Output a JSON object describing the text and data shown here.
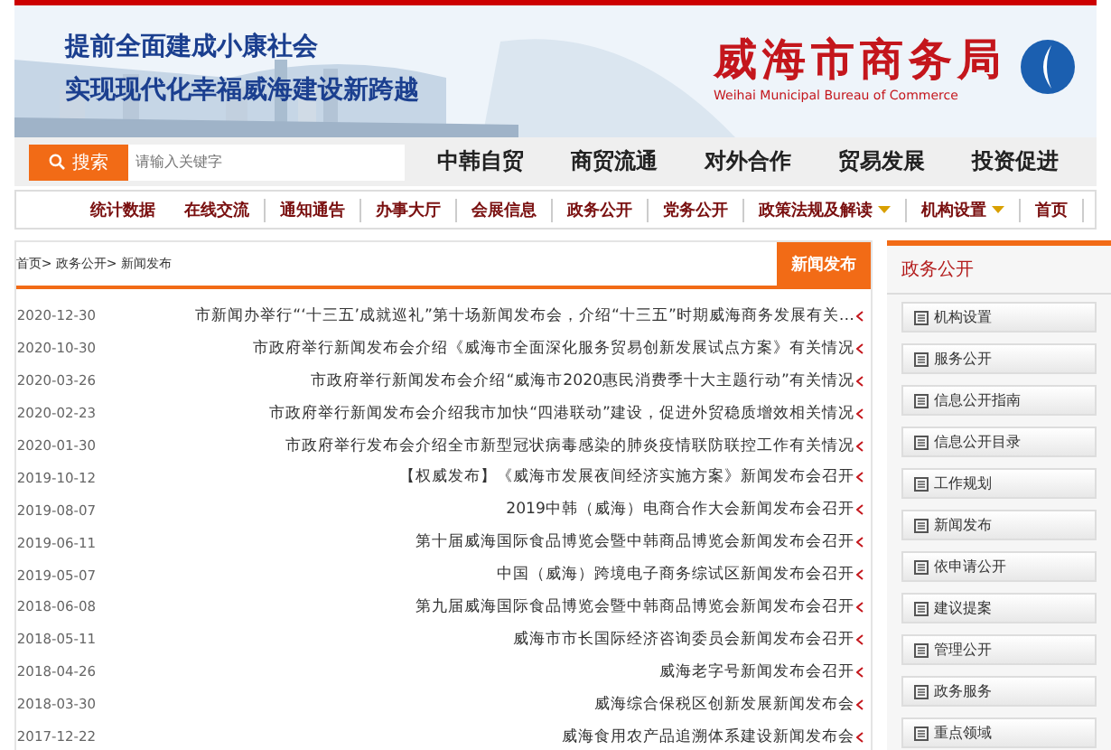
{
  "header": {
    "title": "威海市商务局",
    "subtitle": "Weihai Municipal Bureau of Commerce",
    "slogans": [
      "提前全面建成小康社会",
      "实现现代化幸福威海建设新跨越"
    ]
  },
  "main_nav": [
    "中韩自贸",
    "商贸流通",
    "对外合作",
    "贸易发展",
    "投资促进"
  ],
  "search": {
    "placeholder": "请输入关键字",
    "button": "搜索"
  },
  "sub_nav": [
    {
      "label": "统计数据",
      "dropdown": false
    },
    {
      "label": "在线交流",
      "dropdown": false
    },
    {
      "label": "通知通告",
      "dropdown": false
    },
    {
      "label": "办事大厅",
      "dropdown": false
    },
    {
      "label": "会展信息",
      "dropdown": false
    },
    {
      "label": "政务公开",
      "dropdown": false
    },
    {
      "label": "党务公开",
      "dropdown": false
    },
    {
      "label": "政策法规及解读",
      "dropdown": true
    },
    {
      "label": "机构设置",
      "dropdown": true
    },
    {
      "label": "首页",
      "dropdown": false
    }
  ],
  "sidebar": {
    "title": "政务公开",
    "items": [
      "机构设置",
      "服务公开",
      "信息公开指南",
      "信息公开目录",
      "工作规划",
      "新闻发布",
      "依申请公开",
      "建议提案",
      "管理公开",
      "政务服务",
      "重点领域"
    ]
  },
  "content": {
    "tab": "新闻发布",
    "breadcrumb": "首页> 政务公开> 新闻发布",
    "rows": [
      {
        "title": "市新闻办举行“‘十三五’成就巡礼”第十场新闻发布会，介绍“十三五”时期威海商务发展有关…",
        "date": "2020-12-30"
      },
      {
        "title": "市政府举行新闻发布会介绍《威海市全面深化服务贸易创新发展试点方案》有关情况",
        "date": "2020-10-30"
      },
      {
        "title": "市政府举行新闻发布会介绍“威海市2020惠民消费季十大主题行动”有关情况",
        "date": "2020-03-26"
      },
      {
        "title": "市政府举行新闻发布会介绍我市加快“四港联动”建设，促进外贸稳质增效相关情况",
        "date": "2020-02-23"
      },
      {
        "title": "市政府举行发布会介绍全市新型冠状病毒感染的肺炎疫情联防联控工作有关情况",
        "date": "2020-01-30"
      },
      {
        "title": "【权威发布】《威海市发展夜间经济实施方案》新闻发布会召开",
        "date": "2019-10-12"
      },
      {
        "title": "2019中韩（威海）电商合作大会新闻发布会召开",
        "date": "2019-08-07"
      },
      {
        "title": "第十届威海国际食品博览会暨中韩商品博览会新闻发布会召开",
        "date": "2019-06-11"
      },
      {
        "title": "中国（威海）跨境电子商务综试区新闻发布会召开",
        "date": "2019-05-07"
      },
      {
        "title": "第九届威海国际食品博览会暨中韩商品博览会新闻发布会召开",
        "date": "2018-06-08"
      },
      {
        "title": "威海市市长国际经济咨询委员会新闻发布会召开",
        "date": "2018-05-11"
      },
      {
        "title": "威海老字号新闻发布会召开",
        "date": "2018-04-26"
      },
      {
        "title": "威海综合保税区创新发展新闻发布会",
        "date": "2018-03-30"
      },
      {
        "title": "威海食用农产品追溯体系建设新闻发布会",
        "date": "2017-12-22"
      }
    ]
  }
}
